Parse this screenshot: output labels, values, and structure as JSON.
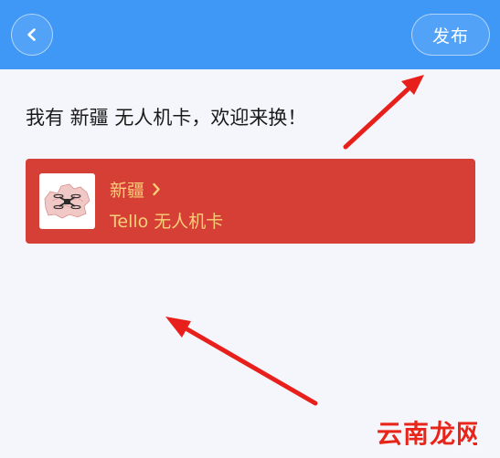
{
  "header": {
    "back_icon": "chevron-left-icon",
    "publish_label": "发布"
  },
  "post": {
    "text": "我有 新疆 无人机卡，欢迎来换！"
  },
  "card": {
    "region": "新疆",
    "region_icon": "chevron-right-icon",
    "title": "Tello 无人机卡",
    "thumbnail": "drone-map-icon"
  },
  "colors": {
    "header": "#3f98f6",
    "card": "#d53f36",
    "card_text": "#f9cf78",
    "annotation_arrow": "#e8201c",
    "watermark": "#e8251b"
  },
  "watermark": {
    "text": "云南龙网"
  }
}
